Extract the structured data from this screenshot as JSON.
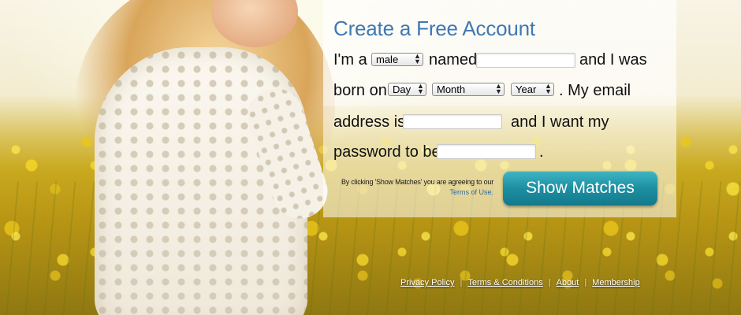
{
  "colors": {
    "title": "#3f78b4",
    "button": "#1d8fa1",
    "terms_link": "#2a6aa8"
  },
  "form": {
    "title": "Create a Free Account",
    "text_im_a": "I'm a",
    "gender_selected": "male",
    "text_named": "named",
    "text_and_i_was": "and I was",
    "text_born_on": "born on",
    "day_selected": "Day",
    "month_selected": "Month",
    "year_selected": "Year",
    "text_my_email": ". My email",
    "text_address_is": "address is",
    "text_and_i_want_my": "and I want my",
    "text_password_to_be": "password to be",
    "text_period": ".",
    "name_value": "",
    "email_value": "",
    "password_value": ""
  },
  "terms": {
    "notice": "By clicking 'Show Matches' you are agreeing to our",
    "link": "Terms of Use."
  },
  "submit_label": "Show Matches",
  "footer": {
    "links": [
      "Privacy Policy",
      "Terms & Conditions",
      "About",
      "Membership"
    ],
    "separator": "|"
  }
}
